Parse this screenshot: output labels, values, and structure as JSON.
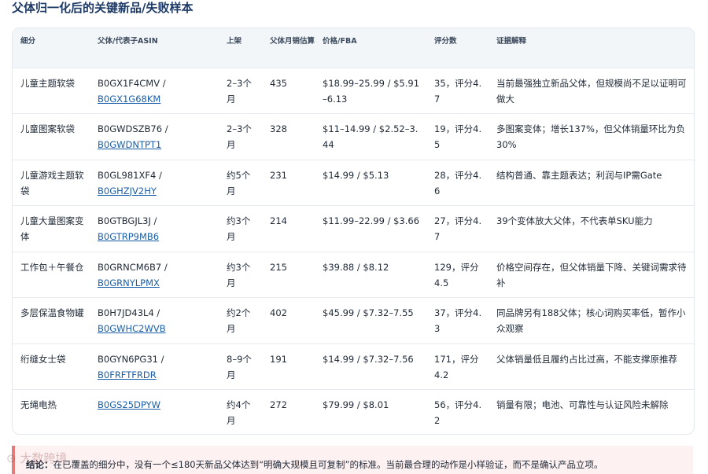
{
  "title": "父体归一化后的关键新品/失败样本",
  "table": {
    "headers": [
      "细分",
      "父体/代表子ASIN",
      "上架",
      "父体月销估算",
      "价格/FBA",
      "评分数",
      "证据解释"
    ],
    "rows": [
      {
        "segment": "儿童主题软袋",
        "asin_main": "B0GX1F4CMV /",
        "asin_link": "B0GX1G68KM",
        "listed": "2–3个月",
        "sales": "435",
        "price": "$18.99–25.99 / $5.91–6.13",
        "rating": "35，评分4.7",
        "evidence": "当前最强独立新品父体，但规模尚不足以证明可做大"
      },
      {
        "segment": "儿童图案软袋",
        "asin_main": "B0GWDSZB76 /",
        "asin_link": "B0GWDNTPT1",
        "listed": "2–3个月",
        "sales": "328",
        "price": "$11–14.99 / $2.52–3.44",
        "rating": "19，评分4.5",
        "evidence": "多图案变体；增长137%，但父体销量环比为负30%"
      },
      {
        "segment": "儿童游戏主题软袋",
        "asin_main": "B0GL981XF4 /",
        "asin_link": "B0GHZJV2HY",
        "listed": "约5个月",
        "sales": "231",
        "price": "$14.99 / $5.13",
        "rating": "28，评分4.6",
        "evidence": "结构普通、靠主题表达；利润与IP需Gate"
      },
      {
        "segment": "儿童大量图案变体",
        "asin_main": "B0GTBGJL3J /",
        "asin_link": "B0GTRP9MB6",
        "listed": "约3个月",
        "sales": "214",
        "price": "$11.99–22.99 / $3.66",
        "rating": "27，评分4.7",
        "evidence": "39个变体放大父体，不代表单SKU能力"
      },
      {
        "segment": "工作包＋午餐仓",
        "asin_main": "B0GRNCM6B7 /",
        "asin_link": "B0GRNYLPMX",
        "listed": "约3个月",
        "sales": "215",
        "price": "$39.88 / $8.12",
        "rating": "129，评分4.5",
        "evidence": "价格空间存在，但父体销量下降、关键词需求待补"
      },
      {
        "segment": "多层保温食物罐",
        "asin_main": "B0H7JD43L4 /",
        "asin_link": "B0GWHC2WVB",
        "listed": "约2个月",
        "sales": "402",
        "price": "$45.99 / $7.32–7.55",
        "rating": "37，评分4.3",
        "evidence": "同品牌另有188父体；核心词购买率低，暂作小众观察"
      },
      {
        "segment": "绗缝女士袋",
        "asin_main": "B0GYN6PG31 /",
        "asin_link": "B0FRFTFRDR",
        "listed": "8–9个月",
        "sales": "191",
        "price": "$14.99 / $7.32–7.56",
        "rating": "171，评分4.2",
        "evidence": "父体销量低且履约占比过高，不能支撑原推荐"
      },
      {
        "segment": "无绳电热",
        "asin_main": "",
        "asin_link": "B0GS25DPYW",
        "listed": "约4个月",
        "sales": "272",
        "price": "$79.99 / $8.01",
        "rating": "56，评分4.2",
        "evidence": "销量有限；电池、可靠性与认证风险未解除"
      }
    ]
  },
  "conclusion": {
    "label": "结论：",
    "text": "在已覆盖的细分中，没有一个≤180天新品父体达到“明确大规模且可复制”的标准。当前最合理的动作是小样验证，而不是确认产品立项。"
  },
  "watermark": "大数跨境"
}
